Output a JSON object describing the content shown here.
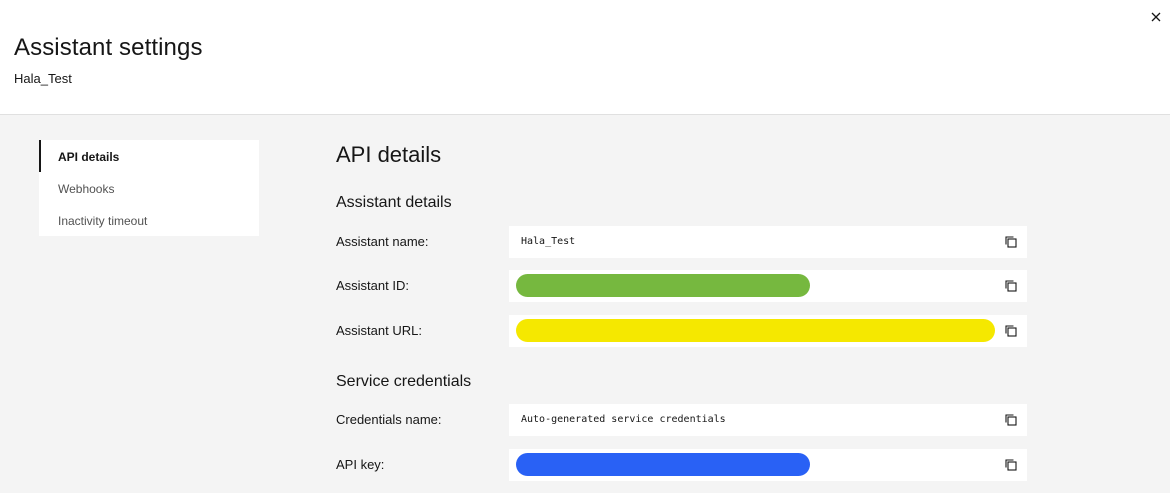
{
  "header": {
    "title": "Assistant settings",
    "subtitle": "Hala_Test",
    "close_icon": "close-icon"
  },
  "sidenav": {
    "items": [
      {
        "label": "API details",
        "active": true
      },
      {
        "label": "Webhooks",
        "active": false
      },
      {
        "label": "Inactivity timeout",
        "active": false
      }
    ]
  },
  "main": {
    "title": "API details",
    "assistant_details": {
      "heading": "Assistant details",
      "name_label": "Assistant name:",
      "name_value": "Hala_Test",
      "id_label": "Assistant ID:",
      "id_redaction_color": "#76b83f",
      "url_label": "Assistant URL:",
      "url_redaction_color": "#f5e800"
    },
    "service_credentials": {
      "heading": "Service credentials",
      "credentials_label": "Credentials name:",
      "credentials_value": "Auto-generated service credentials",
      "api_key_label": "API key:",
      "api_key_redaction_color": "#2961f5"
    },
    "copy_icon": "copy-icon"
  }
}
